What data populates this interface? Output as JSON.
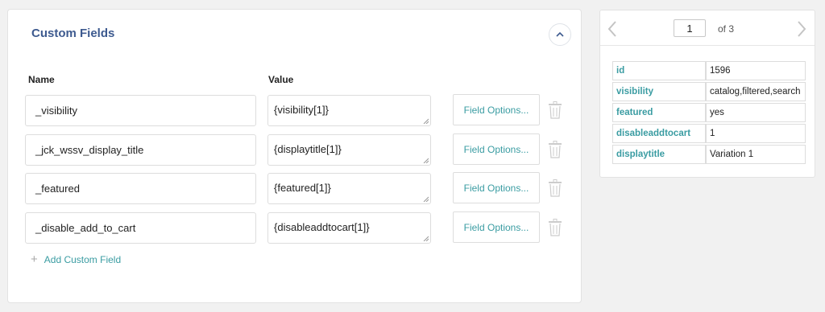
{
  "panel": {
    "title": "Custom Fields",
    "columns": {
      "name": "Name",
      "value": "Value"
    },
    "rows": [
      {
        "name": "_visibility",
        "value": "{visibility[1]}",
        "options_label": "Field Options..."
      },
      {
        "name": "_jck_wssv_display_title",
        "value": "{displaytitle[1]}",
        "options_label": "Field Options..."
      },
      {
        "name": "_featured",
        "value": "{featured[1]}",
        "options_label": "Field Options..."
      },
      {
        "name": "_disable_add_to_cart",
        "value": "{disableaddtocart[1]}",
        "options_label": "Field Options..."
      }
    ],
    "add_label": "Add Custom Field"
  },
  "preview": {
    "page": "1",
    "of_label": "of 3",
    "record": [
      {
        "key": "id",
        "value": "1596"
      },
      {
        "key": "visibility",
        "value": "catalog,filtered,search"
      },
      {
        "key": "featured",
        "value": "yes"
      },
      {
        "key": "disableaddtocart",
        "value": "1"
      },
      {
        "key": "displaytitle",
        "value": "Variation 1"
      }
    ]
  },
  "colors": {
    "accent": "#3a9ca2",
    "title": "#3d5a8f"
  },
  "icons": [
    "chevron-up-icon",
    "trash-icon",
    "plus-icon",
    "chevron-left-icon",
    "chevron-right-icon"
  ]
}
